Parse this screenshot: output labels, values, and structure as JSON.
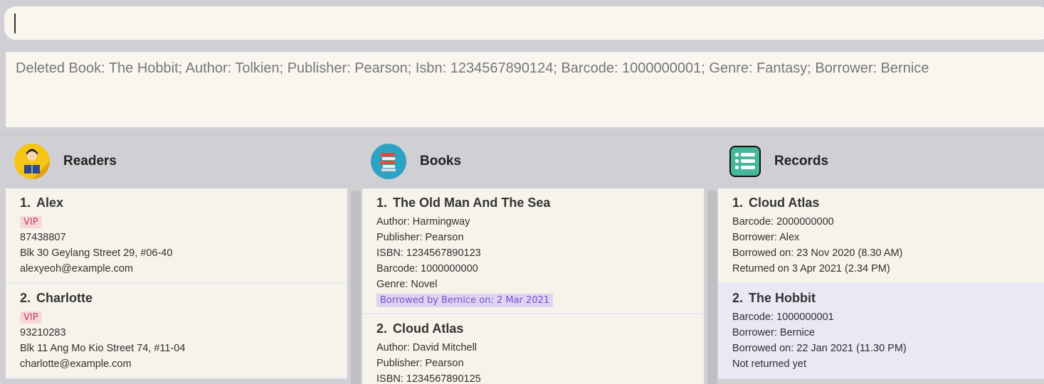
{
  "command": {
    "value": ""
  },
  "result": {
    "text": "Deleted Book: The Hobbit; Author: Tolkien; Publisher: Pearson; Isbn: 1234567890124; Barcode: 1000000001; Genre: Fantasy; Borrower: Bernice"
  },
  "readers": {
    "title": "Readers",
    "icon": "reader-icon",
    "items": [
      {
        "index": "1.",
        "name": "Alex",
        "tag": "VIP",
        "phone": "87438807",
        "address": "Blk 30 Geylang Street 29, #06-40",
        "email": "alexyeoh@example.com"
      },
      {
        "index": "2.",
        "name": "Charlotte",
        "tag": "VIP",
        "phone": "93210283",
        "address": "Blk 11 Ang Mo Kio Street 74, #11-04",
        "email": "charlotte@example.com"
      }
    ]
  },
  "books": {
    "title": "Books",
    "icon": "books-stack-icon",
    "items": [
      {
        "index": "1.",
        "title": "The Old Man And The Sea",
        "author": "Author: Harmingway",
        "publisher": "Publisher: Pearson",
        "isbn": "ISBN: 1234567890123",
        "barcode": "Barcode: 1000000000",
        "genre": "Genre: Novel",
        "borrowed": "Borrowed by Bernice on: 2 Mar 2021"
      },
      {
        "index": "2.",
        "title": "Cloud Atlas",
        "author": "Author: David Mitchell",
        "publisher": "Publisher: Pearson",
        "isbn": "ISBN: 1234567890125"
      }
    ]
  },
  "records": {
    "title": "Records",
    "icon": "records-list-icon",
    "items": [
      {
        "index": "1.",
        "title": "Cloud Atlas",
        "barcode": "Barcode: 2000000000",
        "borrower": "Borrower: Alex",
        "borrowed_on": "Borrowed on: 23 Nov 2020 (8.30 AM)",
        "returned": "Returned on 3 Apr 2021 (2.34 PM)"
      },
      {
        "index": "2.",
        "title": "The Hobbit",
        "barcode": "Barcode: 1000000001",
        "borrower": "Borrower: Bernice",
        "borrowed_on": "Borrowed on: 22 Jan 2021 (11.30 PM)",
        "returned": "Not returned yet"
      }
    ]
  },
  "colors": {
    "background": "#d0cfd3",
    "card": "#f6f4ea",
    "selected": "#e8e9f5",
    "vip_tag": "#f7d7db",
    "borrow_tag": "#ddd3f2"
  }
}
